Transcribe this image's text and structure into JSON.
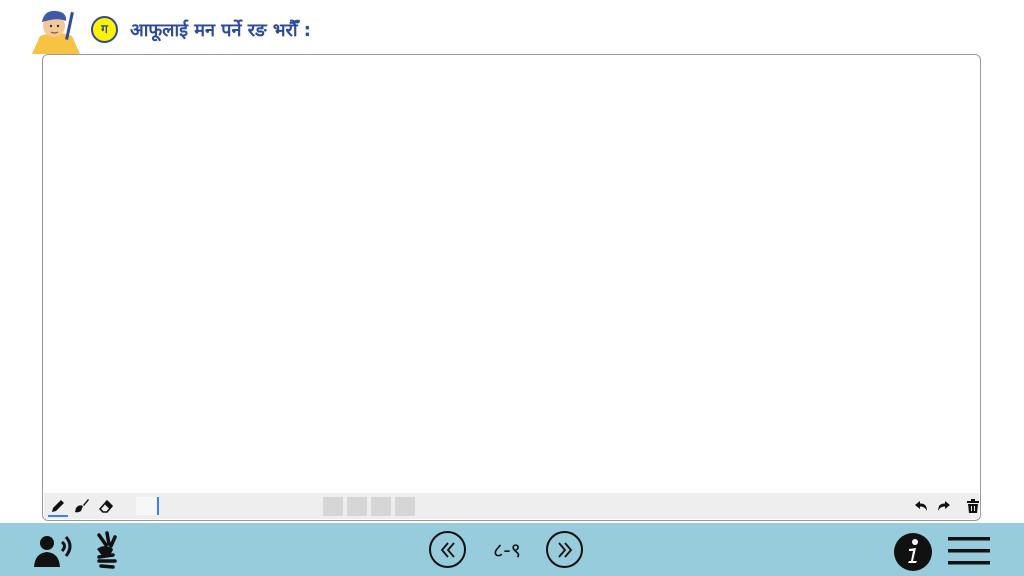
{
  "header": {
    "badge_label": "ग",
    "instruction": "आफूलाई मन पर्ने रङ भरौँ :",
    "mascot_icon": "boy-with-pencil-icon"
  },
  "toolbar": {
    "tools": [
      "pencil-icon",
      "paint-brush-icon",
      "eraser-icon"
    ],
    "active_tool": "pencil",
    "actions": [
      "undo-icon",
      "redo-icon",
      "trash-icon"
    ],
    "swatch_colors": [
      "#d6d6d6",
      "#d6d6d6",
      "#d6d6d6",
      "#d6d6d6"
    ]
  },
  "footer": {
    "page_number": "८-९",
    "icons": [
      "audio-speaker-icon",
      "sign-language-icon",
      "previous-page-icon",
      "next-page-icon",
      "info-icon",
      "menu-icon"
    ]
  },
  "colors": {
    "title": "#2d4b9b",
    "badge_fill": "#fff200",
    "footer_bg": "#96ccdb",
    "toolbar_bg": "#eeeeee",
    "accent": "#3b82f6"
  }
}
